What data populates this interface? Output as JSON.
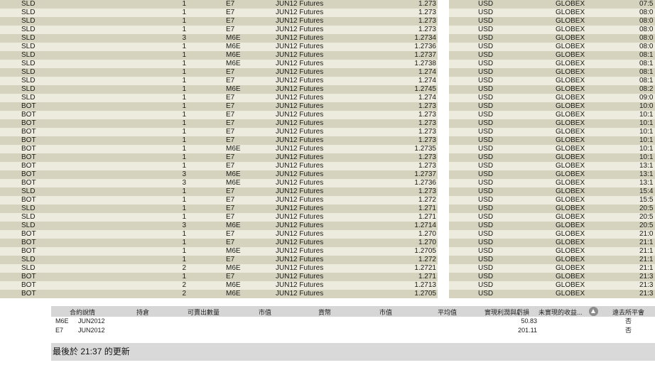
{
  "trades": [
    {
      "side": "SLD",
      "qty": "1",
      "symbol": "E7",
      "desc": "JUN12 Futures",
      "price": "1.273",
      "currency": "USD",
      "exchange": "GLOBEX",
      "time": "07:5"
    },
    {
      "side": "SLD",
      "qty": "1",
      "symbol": "E7",
      "desc": "JUN12 Futures",
      "price": "1.273",
      "currency": "USD",
      "exchange": "GLOBEX",
      "time": "08:0"
    },
    {
      "side": "SLD",
      "qty": "1",
      "symbol": "E7",
      "desc": "JUN12 Futures",
      "price": "1.273",
      "currency": "USD",
      "exchange": "GLOBEX",
      "time": "08:0"
    },
    {
      "side": "SLD",
      "qty": "1",
      "symbol": "E7",
      "desc": "JUN12 Futures",
      "price": "1.273",
      "currency": "USD",
      "exchange": "GLOBEX",
      "time": "08:0"
    },
    {
      "side": "SLD",
      "qty": "3",
      "symbol": "M6E",
      "desc": "JUN12 Futures",
      "price": "1.2734",
      "currency": "USD",
      "exchange": "GLOBEX",
      "time": "08:0"
    },
    {
      "side": "SLD",
      "qty": "1",
      "symbol": "M6E",
      "desc": "JUN12 Futures",
      "price": "1.2736",
      "currency": "USD",
      "exchange": "GLOBEX",
      "time": "08:0"
    },
    {
      "side": "SLD",
      "qty": "1",
      "symbol": "M6E",
      "desc": "JUN12 Futures",
      "price": "1.2737",
      "currency": "USD",
      "exchange": "GLOBEX",
      "time": "08:1"
    },
    {
      "side": "SLD",
      "qty": "1",
      "symbol": "M6E",
      "desc": "JUN12 Futures",
      "price": "1.2738",
      "currency": "USD",
      "exchange": "GLOBEX",
      "time": "08:1"
    },
    {
      "side": "SLD",
      "qty": "1",
      "symbol": "E7",
      "desc": "JUN12 Futures",
      "price": "1.274",
      "currency": "USD",
      "exchange": "GLOBEX",
      "time": "08:1"
    },
    {
      "side": "SLD",
      "qty": "1",
      "symbol": "E7",
      "desc": "JUN12 Futures",
      "price": "1.274",
      "currency": "USD",
      "exchange": "GLOBEX",
      "time": "08:1"
    },
    {
      "side": "SLD",
      "qty": "1",
      "symbol": "M6E",
      "desc": "JUN12 Futures",
      "price": "1.2745",
      "currency": "USD",
      "exchange": "GLOBEX",
      "time": "08:2"
    },
    {
      "side": "SLD",
      "qty": "1",
      "symbol": "E7",
      "desc": "JUN12 Futures",
      "price": "1.274",
      "currency": "USD",
      "exchange": "GLOBEX",
      "time": "09:0"
    },
    {
      "side": "BOT",
      "qty": "1",
      "symbol": "E7",
      "desc": "JUN12 Futures",
      "price": "1.273",
      "currency": "USD",
      "exchange": "GLOBEX",
      "time": "10:0"
    },
    {
      "side": "BOT",
      "qty": "1",
      "symbol": "E7",
      "desc": "JUN12 Futures",
      "price": "1.273",
      "currency": "USD",
      "exchange": "GLOBEX",
      "time": "10:1"
    },
    {
      "side": "BOT",
      "qty": "1",
      "symbol": "E7",
      "desc": "JUN12 Futures",
      "price": "1.273",
      "currency": "USD",
      "exchange": "GLOBEX",
      "time": "10:1"
    },
    {
      "side": "BOT",
      "qty": "1",
      "symbol": "E7",
      "desc": "JUN12 Futures",
      "price": "1.273",
      "currency": "USD",
      "exchange": "GLOBEX",
      "time": "10:1"
    },
    {
      "side": "BOT",
      "qty": "1",
      "symbol": "E7",
      "desc": "JUN12 Futures",
      "price": "1.273",
      "currency": "USD",
      "exchange": "GLOBEX",
      "time": "10:1"
    },
    {
      "side": "BOT",
      "qty": "1",
      "symbol": "M6E",
      "desc": "JUN12 Futures",
      "price": "1.2735",
      "currency": "USD",
      "exchange": "GLOBEX",
      "time": "10:1"
    },
    {
      "side": "BOT",
      "qty": "1",
      "symbol": "E7",
      "desc": "JUN12 Futures",
      "price": "1.273",
      "currency": "USD",
      "exchange": "GLOBEX",
      "time": "10:1"
    },
    {
      "side": "BOT",
      "qty": "1",
      "symbol": "E7",
      "desc": "JUN12 Futures",
      "price": "1.273",
      "currency": "USD",
      "exchange": "GLOBEX",
      "time": "13:1"
    },
    {
      "side": "BOT",
      "qty": "3",
      "symbol": "M6E",
      "desc": "JUN12 Futures",
      "price": "1.2737",
      "currency": "USD",
      "exchange": "GLOBEX",
      "time": "13:1"
    },
    {
      "side": "BOT",
      "qty": "3",
      "symbol": "M6E",
      "desc": "JUN12 Futures",
      "price": "1.2736",
      "currency": "USD",
      "exchange": "GLOBEX",
      "time": "13:1"
    },
    {
      "side": "SLD",
      "qty": "1",
      "symbol": "E7",
      "desc": "JUN12 Futures",
      "price": "1.273",
      "currency": "USD",
      "exchange": "GLOBEX",
      "time": "15:4"
    },
    {
      "side": "BOT",
      "qty": "1",
      "symbol": "E7",
      "desc": "JUN12 Futures",
      "price": "1.272",
      "currency": "USD",
      "exchange": "GLOBEX",
      "time": "15:5"
    },
    {
      "side": "SLD",
      "qty": "1",
      "symbol": "E7",
      "desc": "JUN12 Futures",
      "price": "1.271",
      "currency": "USD",
      "exchange": "GLOBEX",
      "time": "20:5"
    },
    {
      "side": "SLD",
      "qty": "1",
      "symbol": "E7",
      "desc": "JUN12 Futures",
      "price": "1.271",
      "currency": "USD",
      "exchange": "GLOBEX",
      "time": "20:5"
    },
    {
      "side": "SLD",
      "qty": "3",
      "symbol": "M6E",
      "desc": "JUN12 Futures",
      "price": "1.2714",
      "currency": "USD",
      "exchange": "GLOBEX",
      "time": "20:5"
    },
    {
      "side": "BOT",
      "qty": "1",
      "symbol": "E7",
      "desc": "JUN12 Futures",
      "price": "1.270",
      "currency": "USD",
      "exchange": "GLOBEX",
      "time": "21:0"
    },
    {
      "side": "BOT",
      "qty": "1",
      "symbol": "E7",
      "desc": "JUN12 Futures",
      "price": "1.270",
      "currency": "USD",
      "exchange": "GLOBEX",
      "time": "21:1"
    },
    {
      "side": "BOT",
      "qty": "1",
      "symbol": "M6E",
      "desc": "JUN12 Futures",
      "price": "1.2705",
      "currency": "USD",
      "exchange": "GLOBEX",
      "time": "21:1"
    },
    {
      "side": "SLD",
      "qty": "1",
      "symbol": "E7",
      "desc": "JUN12 Futures",
      "price": "1.272",
      "currency": "USD",
      "exchange": "GLOBEX",
      "time": "21:1"
    },
    {
      "side": "SLD",
      "qty": "2",
      "symbol": "M6E",
      "desc": "JUN12 Futures",
      "price": "1.2721",
      "currency": "USD",
      "exchange": "GLOBEX",
      "time": "21:1"
    },
    {
      "side": "BOT",
      "qty": "1",
      "symbol": "E7",
      "desc": "JUN12 Futures",
      "price": "1.271",
      "currency": "USD",
      "exchange": "GLOBEX",
      "time": "21:3"
    },
    {
      "side": "BOT",
      "qty": "2",
      "symbol": "M6E",
      "desc": "JUN12 Futures",
      "price": "1.2713",
      "currency": "USD",
      "exchange": "GLOBEX",
      "time": "21:3"
    },
    {
      "side": "BOT",
      "qty": "2",
      "symbol": "M6E",
      "desc": "JUN12 Futures",
      "price": "1.2705",
      "currency": "USD",
      "exchange": "GLOBEX",
      "time": "21:3"
    }
  ],
  "portfolio": {
    "headers": {
      "contract": "合約說情",
      "position": "持倉",
      "available": "可賣出數量",
      "market_price": "市值",
      "currency": "貨幣",
      "market_value": "市值",
      "avg_price": "平均值",
      "realized_pnl": "實現利潤與虧損",
      "unrealized_pnl": "未實現的收益...",
      "exchange_margin": "遠去所平會"
    },
    "rows": [
      {
        "symbol": "M6E",
        "expiry": "JUN2012",
        "realized_pnl": "50.83",
        "exchange_margin": "否"
      },
      {
        "symbol": "E7",
        "expiry": "JUN2012",
        "realized_pnl": "201.11",
        "exchange_margin": "否"
      }
    ],
    "status": "最後於 21:37 的更新"
  },
  "colors": {
    "row_odd": "#d5d3bd",
    "row_even": "#ecebdd",
    "header_bg": "#d6d6d6",
    "status_bg": "#d9d9d9"
  },
  "icons": {
    "sort": "sort-ascending-icon"
  }
}
